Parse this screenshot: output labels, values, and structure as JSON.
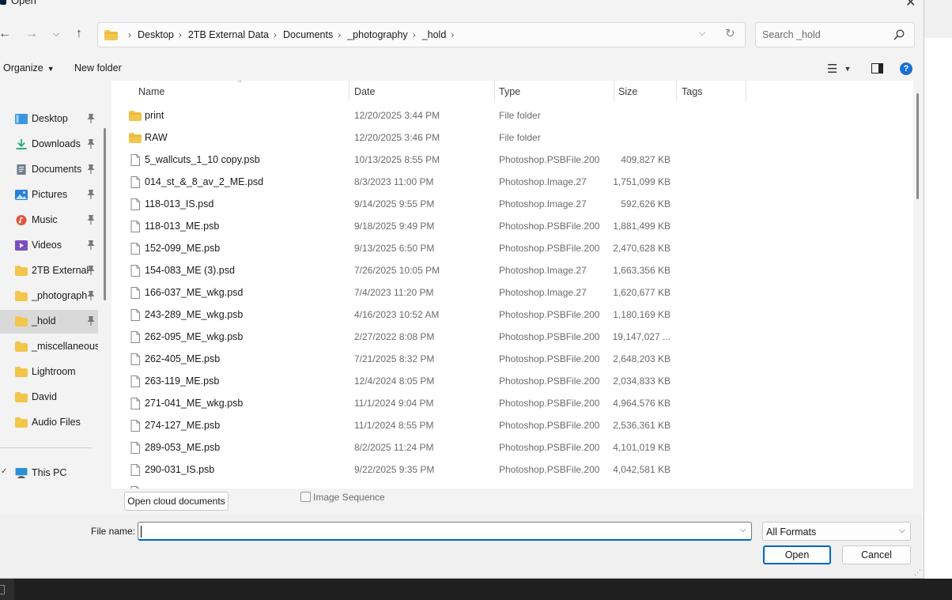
{
  "window": {
    "title": "Open"
  },
  "address": {
    "breadcrumbs": [
      "Desktop",
      "2TB External Data",
      "Documents",
      "_photography",
      "_hold"
    ]
  },
  "search": {
    "placeholder": "Search _hold"
  },
  "toolbar": {
    "organize_label": "Organize",
    "new_folder_label": "New folder"
  },
  "sidebar": {
    "items": [
      {
        "label": "Desktop",
        "icon": "desktop-icon",
        "pinned": true,
        "color": "#3a96dd"
      },
      {
        "label": "Downloads",
        "icon": "download-icon",
        "pinned": true,
        "color": "#1aa37f"
      },
      {
        "label": "Documents",
        "icon": "documents-icon",
        "pinned": true,
        "color": "#6b7b8c"
      },
      {
        "label": "Pictures",
        "icon": "pictures-icon",
        "pinned": true,
        "color": "#2a7fd4"
      },
      {
        "label": "Music",
        "icon": "music-icon",
        "pinned": true,
        "color": "#e0533d"
      },
      {
        "label": "Videos",
        "icon": "videos-icon",
        "pinned": true,
        "color": "#7a4fc0"
      },
      {
        "label": "2TB External",
        "icon": "folder-icon",
        "pinned": true,
        "color": "#f2c54b"
      },
      {
        "label": "_photograph",
        "icon": "folder-icon",
        "pinned": true,
        "color": "#f2c54b"
      },
      {
        "label": "_hold",
        "icon": "folder-icon",
        "pinned": true,
        "selected": true,
        "color": "#f2c54b"
      },
      {
        "label": "_miscellaneous",
        "icon": "folder-icon",
        "pinned": false,
        "color": "#f2c54b"
      },
      {
        "label": "Lightroom",
        "icon": "folder-icon",
        "pinned": false,
        "color": "#f2c54b"
      },
      {
        "label": "David",
        "icon": "folder-icon",
        "pinned": false,
        "color": "#f2c54b"
      },
      {
        "label": "Audio Files",
        "icon": "folder-icon",
        "pinned": false,
        "color": "#f2c54b"
      }
    ],
    "this_pc_label": "This PC"
  },
  "columns": {
    "name": "Name",
    "date": "Date",
    "type": "Type",
    "size": "Size",
    "tags": "Tags"
  },
  "files": [
    {
      "name": "print",
      "date": "12/20/2025 3:44 PM",
      "type": "File folder",
      "size": "",
      "kind": "folder"
    },
    {
      "name": "RAW",
      "date": "12/20/2025 3:46 PM",
      "type": "File folder",
      "size": "",
      "kind": "folder"
    },
    {
      "name": "5_wallcuts_1_10 copy.psb",
      "date": "10/13/2025 8:55 PM",
      "type": "Photoshop.PSBFile.200",
      "size": "409,827 KB",
      "kind": "file"
    },
    {
      "name": "014_st_&_8_av_2_ME.psd",
      "date": "8/3/2023 11:00 PM",
      "type": "Photoshop.Image.27",
      "size": "1,751,099 KB",
      "kind": "file"
    },
    {
      "name": "118-013_IS.psd",
      "date": "9/14/2025 9:55 PM",
      "type": "Photoshop.Image.27",
      "size": "592,626 KB",
      "kind": "file"
    },
    {
      "name": "118-013_ME.psb",
      "date": "9/18/2025 9:49 PM",
      "type": "Photoshop.PSBFile.200",
      "size": "1,881,499 KB",
      "kind": "file"
    },
    {
      "name": "152-099_ME.psb",
      "date": "9/13/2025 6:50 PM",
      "type": "Photoshop.PSBFile.200",
      "size": "2,470,628 KB",
      "kind": "file"
    },
    {
      "name": "154-083_ME (3).psd",
      "date": "7/26/2025 10:05 PM",
      "type": "Photoshop.Image.27",
      "size": "1,663,356 KB",
      "kind": "file"
    },
    {
      "name": "166-037_ME_wkg.psd",
      "date": "7/4/2023 11:20 PM",
      "type": "Photoshop.Image.27",
      "size": "1,620,677 KB",
      "kind": "file"
    },
    {
      "name": "243-289_ME_wkg.psb",
      "date": "4/16/2023 10:52 AM",
      "type": "Photoshop.PSBFile.200",
      "size": "1,180,169 KB",
      "kind": "file"
    },
    {
      "name": "262-095_ME_wkg.psb",
      "date": "2/27/2022 8:08 PM",
      "type": "Photoshop.PSBFile.200",
      "size": "19,147,027 ...",
      "kind": "file"
    },
    {
      "name": "262-405_ME.psb",
      "date": "7/21/2025 8:32 PM",
      "type": "Photoshop.PSBFile.200",
      "size": "2,648,203 KB",
      "kind": "file"
    },
    {
      "name": "263-119_ME.psb",
      "date": "12/4/2024 8:05 PM",
      "type": "Photoshop.PSBFile.200",
      "size": "2,034,833 KB",
      "kind": "file"
    },
    {
      "name": "271-041_ME_wkg.psb",
      "date": "11/1/2024 9:04 PM",
      "type": "Photoshop.PSBFile.200",
      "size": "4,964,576 KB",
      "kind": "file"
    },
    {
      "name": "274-127_ME.psb",
      "date": "11/1/2024 8:55 PM",
      "type": "Photoshop.PSBFile.200",
      "size": "2,536,361 KB",
      "kind": "file"
    },
    {
      "name": "289-053_ME.psb",
      "date": "8/2/2025 11:24 PM",
      "type": "Photoshop.PSBFile.200",
      "size": "4,101,019 KB",
      "kind": "file"
    },
    {
      "name": "290-031_IS.psb",
      "date": "9/22/2025 9:35 PM",
      "type": "Photoshop.PSBFile.200",
      "size": "4,042,581 KB",
      "kind": "file"
    }
  ],
  "lower": {
    "cloud_button_label": "Open cloud documents",
    "image_sequence_label": "Image Sequence",
    "file_name_label": "File name:",
    "file_name_value": "",
    "format_value": "All Formats",
    "open_label": "Open",
    "cancel_label": "Cancel"
  },
  "colors": {
    "accent": "#0067c0",
    "folder": "#f2c54b",
    "help": "#1c6fd1",
    "selected_bg": "#d9d9d9"
  }
}
